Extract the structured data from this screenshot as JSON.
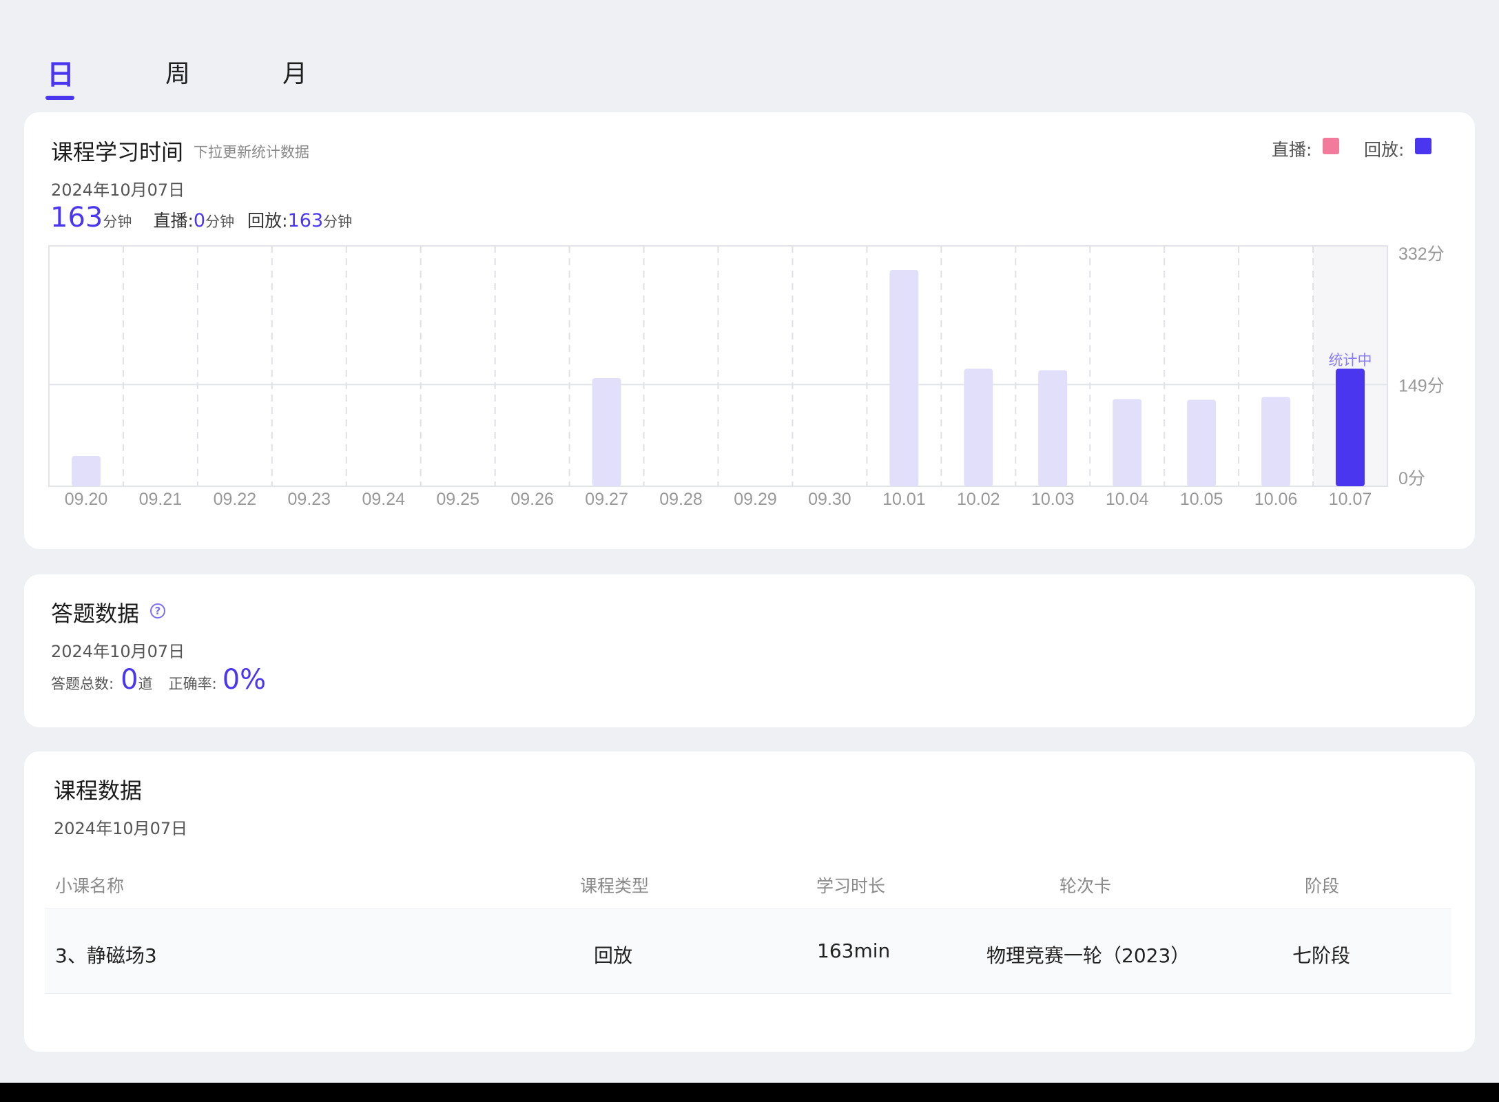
{
  "tabs": [
    {
      "label": "日",
      "active": true
    },
    {
      "label": "周",
      "active": false
    },
    {
      "label": "月",
      "active": false
    }
  ],
  "study_time": {
    "title": "课程学习时间",
    "hint": "下拉更新统计数据",
    "legend": [
      {
        "label": "直播:",
        "color": "#f27a9a"
      },
      {
        "label": "回放:",
        "color": "#4b36f0"
      }
    ],
    "date": "2024年10月07日",
    "total_value": "163",
    "total_unit": "分钟",
    "live_label": "直播:",
    "live_value": "0",
    "live_unit": "分钟",
    "replay_label": "回放:",
    "replay_value": "163",
    "replay_unit": "分钟"
  },
  "chart_data": {
    "type": "bar",
    "categories": [
      "09.20",
      "09.21",
      "09.22",
      "09.23",
      "09.24",
      "09.25",
      "09.26",
      "09.27",
      "09.28",
      "09.29",
      "09.30",
      "10.01",
      "10.02",
      "10.03",
      "10.04",
      "10.05",
      "10.06",
      "10.07"
    ],
    "series": [
      {
        "name": "回放",
        "values": [
          42,
          0,
          0,
          0,
          0,
          0,
          0,
          150,
          0,
          0,
          0,
          300,
          163,
          161,
          121,
          120,
          124,
          163
        ]
      }
    ],
    "y_ticks": [
      "332分",
      "149分",
      "0分"
    ],
    "ylim": [
      0,
      332
    ],
    "highlight_index": 17,
    "highlight_label": "统计中",
    "colors": {
      "bar": "#e2dffb",
      "highlight": "#4b36f0",
      "highlight_bg": "#f6f6f8"
    },
    "grid": true
  },
  "answers": {
    "title": "答题数据",
    "help_icon": "question-circle-icon",
    "date": "2024年10月07日",
    "total_label": "答题总数:",
    "total_value": "0",
    "total_unit": "道",
    "accuracy_label": "正确率:",
    "accuracy_value": "0%"
  },
  "courses": {
    "title": "课程数据",
    "date": "2024年10月07日",
    "columns": [
      "小课名称",
      "课程类型",
      "学习时长",
      "轮次卡",
      "阶段"
    ],
    "rows": [
      [
        "3、静磁场3",
        "回放",
        "163min",
        "物理竞赛一轮（2023）",
        "七阶段"
      ]
    ]
  }
}
